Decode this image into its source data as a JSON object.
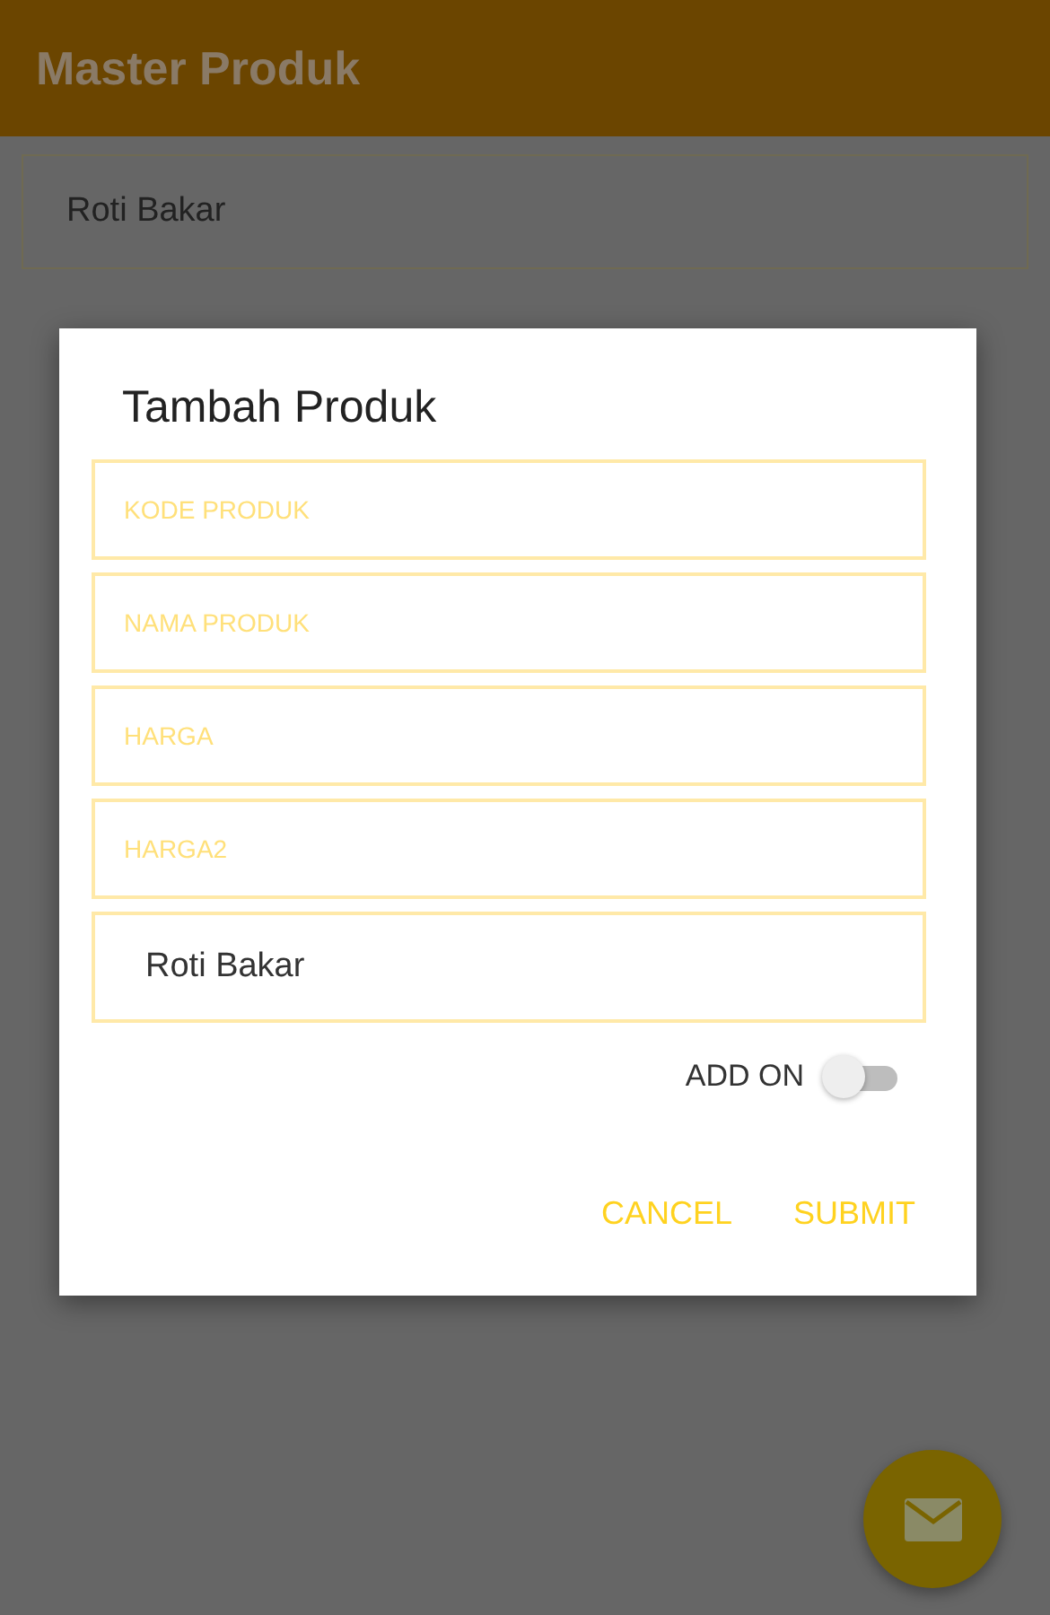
{
  "app_bar": {
    "title": "Master Produk"
  },
  "list": [
    {
      "name": "Roti Bakar"
    }
  ],
  "dialog": {
    "title": "Tambah Produk",
    "fields": [
      {
        "placeholder": "KODE PRODUK"
      },
      {
        "placeholder": "NAMA PRODUK"
      },
      {
        "placeholder": "HARGA"
      },
      {
        "placeholder": "HARGA2"
      },
      {
        "value": "Roti Bakar"
      }
    ],
    "toggle": {
      "label": "ADD ON",
      "on": false
    },
    "buttons": [
      "CANCEL",
      "SUBMIT"
    ]
  }
}
